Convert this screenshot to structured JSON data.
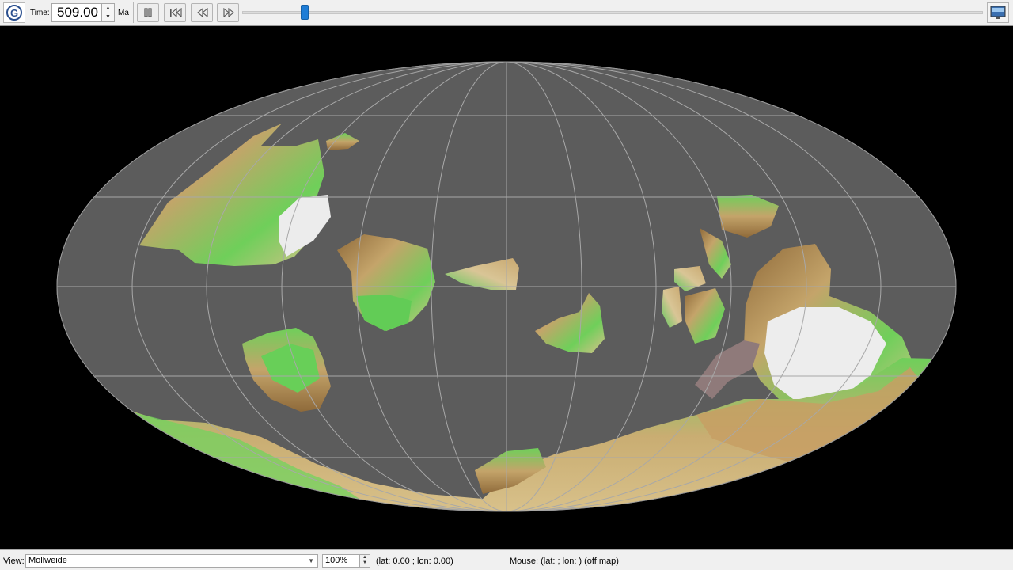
{
  "toolbar": {
    "logo_icon": "gplates-logo-icon",
    "time_label": "Time:",
    "time_value": "509.00",
    "time_unit": "Ma",
    "buttons": [
      {
        "name": "pause-button",
        "icon": "pause-icon"
      },
      {
        "name": "reset-button",
        "icon": "skip-to-start-icon"
      },
      {
        "name": "step-back-button",
        "icon": "rewind-icon"
      },
      {
        "name": "step-forward-button",
        "icon": "fast-forward-icon"
      }
    ],
    "animation_position": 0.08,
    "window_icon": "monitor-icon"
  },
  "map": {
    "background_color": "#000000",
    "ocean_color": "#5c5c5c",
    "graticule_color": "#a8a8a8",
    "land_colors": [
      "#c4a46a",
      "#6fcf5a",
      "#eeeeee",
      "#8f6a3a"
    ]
  },
  "statusbar": {
    "view_label": "View:",
    "projection": "Mollweide",
    "zoom": "100%",
    "camera": "(lat: 0.00 ; lon: 0.00)",
    "mouse": "Mouse: (lat:  ; lon: ) (off map)"
  }
}
